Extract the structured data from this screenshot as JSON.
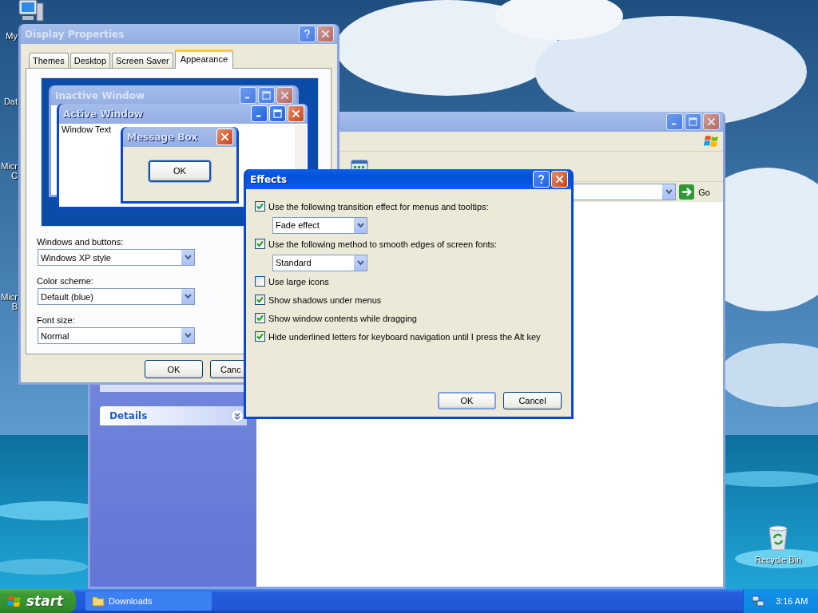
{
  "desktop": {
    "icons": [
      {
        "lines": [
          "My"
        ]
      },
      {
        "lines": [
          "Dat"
        ]
      },
      {
        "lines": [
          "Micr",
          "C"
        ]
      },
      {
        "lines": [
          "Micr",
          "B"
        ]
      }
    ],
    "recycle_bin": {
      "label": "Recycle Bin"
    }
  },
  "explorer": {
    "go_label": "Go",
    "details_title": "Details"
  },
  "display_properties": {
    "title": "Display Properties",
    "tabs": [
      {
        "label": "Themes",
        "selected": false
      },
      {
        "label": "Desktop",
        "selected": false
      },
      {
        "label": "Screen Saver",
        "selected": false
      },
      {
        "label": "Appearance",
        "selected": true
      }
    ],
    "preview": {
      "inactive_title": "Inactive Window",
      "active_title": "Active Window",
      "window_text": "Window Text",
      "message_title": "Message Box",
      "message_button": "OK"
    },
    "fields": [
      {
        "label": "Windows and buttons:",
        "value": "Windows XP style"
      },
      {
        "label": "Color scheme:",
        "value": "Default (blue)"
      },
      {
        "label": "Font size:",
        "value": "Normal"
      }
    ],
    "buttons": [
      "OK",
      "Canc"
    ]
  },
  "effects": {
    "title": "Effects",
    "items": [
      {
        "kind": "checkbox",
        "label": "Use the following transition effect for menus and tooltips:",
        "checked": true
      },
      {
        "kind": "dropdown",
        "value": "Fade effect"
      },
      {
        "kind": "checkbox",
        "label": "Use the following method to smooth edges of screen fonts:",
        "checked": true
      },
      {
        "kind": "dropdown",
        "value": "Standard"
      },
      {
        "kind": "checkbox",
        "label": "Use large icons",
        "checked": false
      },
      {
        "kind": "checkbox",
        "label": "Show shadows under menus",
        "checked": true
      },
      {
        "kind": "checkbox",
        "label": "Show window contents while dragging",
        "checked": true
      },
      {
        "kind": "checkbox",
        "label": "Hide underlined letters for keyboard navigation until I press the Alt key",
        "checked": true
      }
    ],
    "buttons": [
      "OK",
      "Cancel"
    ]
  },
  "taskbar": {
    "start_label": "start",
    "tasks": [
      {
        "label": "Downloads"
      }
    ],
    "clock": "3:16 AM"
  }
}
